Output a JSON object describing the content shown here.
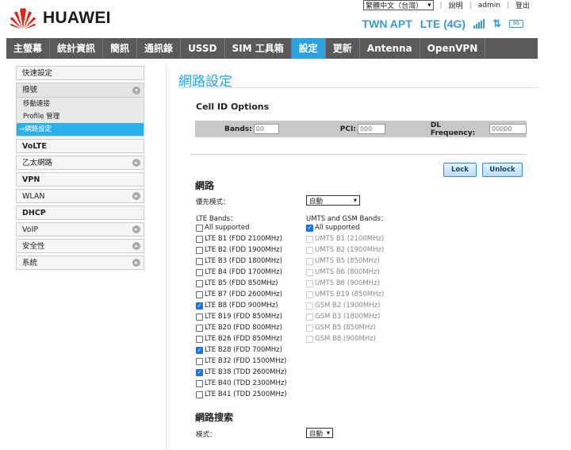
{
  "brand": {
    "name": "HUAWEI"
  },
  "top": {
    "language": "繁體中文（台灣）",
    "help": "說明",
    "user": "admin",
    "logout": "登出"
  },
  "status": {
    "carrier": "TWN APT",
    "network": "LTE (4G)",
    "battery": "5G"
  },
  "nav": [
    "主螢幕",
    "統計資訊",
    "簡訊",
    "通訊錄",
    "USSD",
    "SIM 工具箱",
    "設定",
    "更新",
    "Antenna",
    "OpenVPN"
  ],
  "nav_active": "設定",
  "sidebar": {
    "quick": "快速設定",
    "dial": "撥號",
    "dial_sub": [
      "移動連接",
      "Profile 管理",
      "網路設定"
    ],
    "active_sub": "網路設定",
    "items": [
      "VoLTE",
      "乙太網路",
      "VPN",
      "WLAN",
      "DHCP",
      "VoIP",
      "安全性",
      "系統"
    ]
  },
  "page": {
    "title": "網路設定"
  },
  "cell_id": {
    "title": "Cell ID Options",
    "bands_label": "Bands:",
    "bands_placeholder": "00",
    "pci_label": "PCI:",
    "pci_placeholder": "000",
    "dl_label": "DL Frequency:",
    "dl_placeholder": "00000"
  },
  "buttons": {
    "lock": "Lock",
    "unlock": "Unlock"
  },
  "network": {
    "title": "網路",
    "priority_label": "優先模式：",
    "priority_value": "自動",
    "lte_label": "LTE Bands：",
    "umts_label": "UMTS and GSM Bands：",
    "lte_bands": [
      {
        "label": "All supported",
        "checked": false
      },
      {
        "label": "LTE B1 (FDD 2100MHz)",
        "checked": false
      },
      {
        "label": "LTE B2 (FDD 1900MHz)",
        "checked": false
      },
      {
        "label": "LTE B3 (FDD 1800MHz)",
        "checked": false
      },
      {
        "label": "LTE B4 (FDD 1700MHz)",
        "checked": false
      },
      {
        "label": "LTE B5 (FDD 850MHz)",
        "checked": false
      },
      {
        "label": "LTE B7 (FDD 2600MHz)",
        "checked": false
      },
      {
        "label": "LTE B8 (FDD 900MHz)",
        "checked": true
      },
      {
        "label": "LTE B19 (FDD 850MHz)",
        "checked": false
      },
      {
        "label": "LTE B20 (FDD 800MHz)",
        "checked": false
      },
      {
        "label": "LTE B26 (FDD 850MHz)",
        "checked": false
      },
      {
        "label": "LTE B28 (FDD 700MHz)",
        "checked": true
      },
      {
        "label": "LTE B32 (FDD 1500MHz)",
        "checked": false
      },
      {
        "label": "LTE B38 (TDD 2600MHz)",
        "checked": true
      },
      {
        "label": "LTE B40 (TDD 2300MHz)",
        "checked": false
      },
      {
        "label": "LTE B41 (TDD 2500MHz)",
        "checked": false
      }
    ],
    "umts_bands": [
      {
        "label": "All supported",
        "checked": true,
        "disabled": false
      },
      {
        "label": "UMTS B1 (2100MHz)",
        "checked": false,
        "disabled": true
      },
      {
        "label": "UMTS B2 (1900MHz)",
        "checked": false,
        "disabled": true
      },
      {
        "label": "UMTS B5 (850MHz)",
        "checked": false,
        "disabled": true
      },
      {
        "label": "UMTS B6 (800MHz)",
        "checked": false,
        "disabled": true
      },
      {
        "label": "UMTS B8 (900MHz)",
        "checked": false,
        "disabled": true
      },
      {
        "label": "UMTS B19 (850MHz)",
        "checked": false,
        "disabled": true
      },
      {
        "label": "GSM B2 (1900MHz)",
        "checked": false,
        "disabled": true
      },
      {
        "label": "GSM B3 (1800MHz)",
        "checked": false,
        "disabled": true
      },
      {
        "label": "GSM B5 (850MHz)",
        "checked": false,
        "disabled": true
      },
      {
        "label": "GSM B8 (900MHz)",
        "checked": false,
        "disabled": true
      }
    ]
  },
  "search": {
    "title": "網路搜索",
    "mode_label": "模式：",
    "mode_value": "自動"
  },
  "colors": {
    "accent": "#2aa3e0",
    "nav_bg": "#5a5a5a",
    "brand_red": "#e2231a"
  }
}
